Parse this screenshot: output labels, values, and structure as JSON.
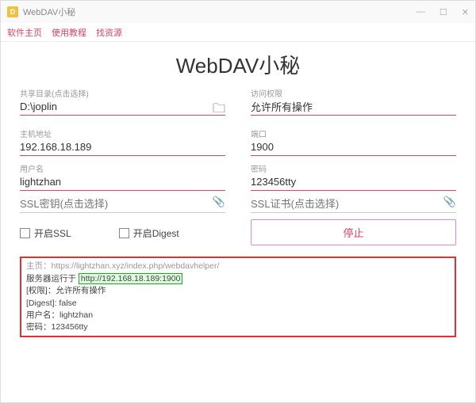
{
  "window": {
    "title": "WebDAV小秘"
  },
  "menu": {
    "home": "软件主页",
    "tutorial": "使用教程",
    "resources": "找资源"
  },
  "heading": "WebDAV小秘",
  "fields": {
    "share_dir": {
      "label": "共享目录(点击选择)",
      "value": "D:\\joplin"
    },
    "access": {
      "label": "访问权限",
      "value": "允许所有操作"
    },
    "host": {
      "label": "主机地址",
      "value": "192.168.18.189"
    },
    "port": {
      "label": "端口",
      "value": "1900"
    },
    "user": {
      "label": "用户名",
      "value": "lightzhan"
    },
    "pass": {
      "label": "密码",
      "value": "123456tty"
    },
    "ssl_key": {
      "placeholder": "SSL密钥(点击选择)"
    },
    "ssl_cert": {
      "placeholder": "SSL证书(点击选择)"
    }
  },
  "checks": {
    "ssl": "开启SSL",
    "digest": "开启Digest"
  },
  "stop_label": "停止",
  "log": {
    "homepage": "主页：https://lightzhan.xyz/index.php/webdavhelper/",
    "running_prefix": "服务器运行于 ",
    "running_url": "http://192.168.18.189:1900",
    "perm": "[权限]：允许所有操作",
    "digest": "[Digest]: false",
    "user": "用户名：lightzhan",
    "pass": "密码：123456tty"
  }
}
